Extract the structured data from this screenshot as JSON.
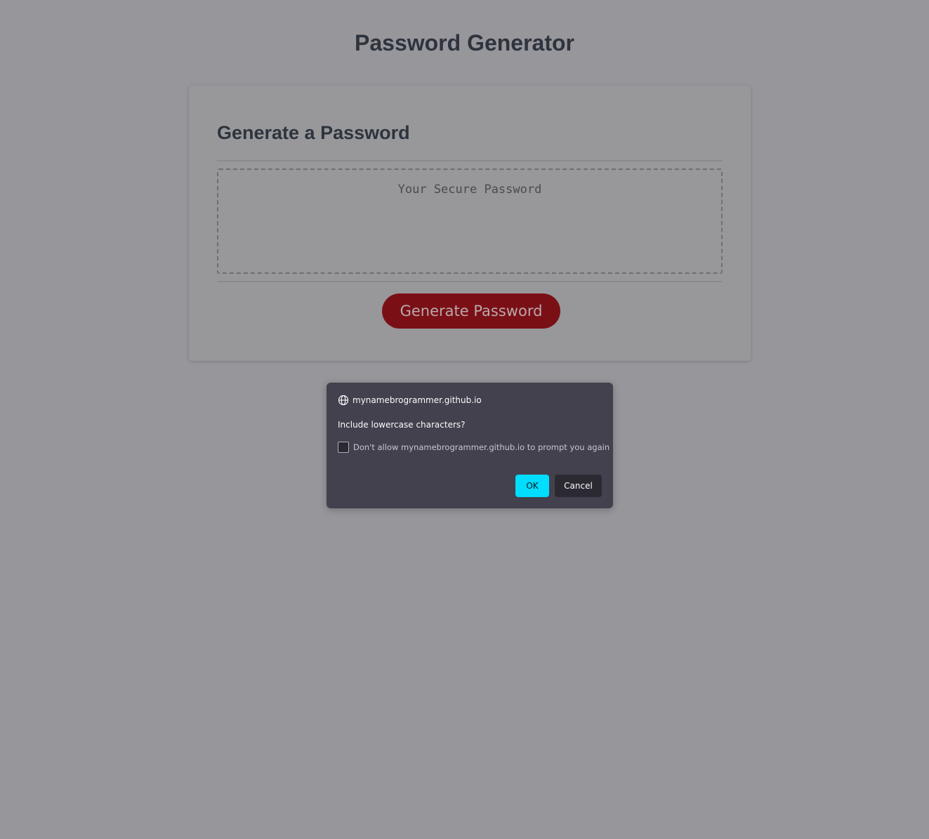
{
  "page": {
    "title": "Password Generator"
  },
  "card": {
    "header": "Generate a Password",
    "password_placeholder": "Your Secure Password",
    "password_value": "",
    "generate_label": "Generate Password"
  },
  "dialog": {
    "origin": "mynamebrogrammer.github.io",
    "message": "Include lowercase characters?",
    "checkbox_label": "Don't allow mynamebrogrammer.github.io to prompt you again",
    "checkbox_checked": false,
    "ok_label": "OK",
    "cancel_label": "Cancel"
  },
  "colors": {
    "overlay_background": "#97969b",
    "heading_text": "#2e343e",
    "generate_button": "#7a1016",
    "dialog_background": "#42414d",
    "ok_button": "#00ddff",
    "cancel_button": "#2b2a33"
  },
  "icons": {
    "origin_icon": "globe-icon"
  }
}
